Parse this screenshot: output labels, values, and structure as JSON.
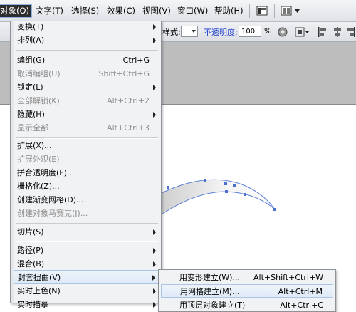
{
  "menubar": {
    "items": [
      "对象(O)",
      "文字(T)",
      "选择(S)",
      "效果(C)",
      "视图(V)",
      "窗口(W)",
      "帮助(H)"
    ]
  },
  "toolbar": {
    "style_label": "样式:",
    "opacity_label": "不透明度:",
    "opacity_value": "100",
    "percent": "%"
  },
  "object_menu": {
    "items": [
      {
        "label": "变换(T)",
        "shortcut": "",
        "submenu": true,
        "disabled": false
      },
      {
        "label": "排列(A)",
        "shortcut": "",
        "submenu": true,
        "disabled": false
      },
      {
        "label": "编组(G)",
        "shortcut": "Ctrl+G",
        "submenu": false,
        "disabled": false
      },
      {
        "label": "取消编组(U)",
        "shortcut": "Shift+Ctrl+G",
        "submenu": false,
        "disabled": true
      },
      {
        "label": "锁定(L)",
        "shortcut": "",
        "submenu": true,
        "disabled": false
      },
      {
        "label": "全部解锁(K)",
        "shortcut": "Alt+Ctrl+2",
        "submenu": false,
        "disabled": true
      },
      {
        "label": "隐藏(H)",
        "shortcut": "",
        "submenu": true,
        "disabled": false
      },
      {
        "label": "显示全部",
        "shortcut": "Alt+Ctrl+3",
        "submenu": false,
        "disabled": true
      },
      {
        "label": "扩展(X)...",
        "shortcut": "",
        "submenu": false,
        "disabled": false
      },
      {
        "label": "扩展外观(E)",
        "shortcut": "",
        "submenu": false,
        "disabled": true
      },
      {
        "label": "拼合透明度(F)...",
        "shortcut": "",
        "submenu": false,
        "disabled": false
      },
      {
        "label": "栅格化(Z)...",
        "shortcut": "",
        "submenu": false,
        "disabled": false
      },
      {
        "label": "创建渐变网格(D)...",
        "shortcut": "",
        "submenu": false,
        "disabled": false
      },
      {
        "label": "创建对象马赛克(J)...",
        "shortcut": "",
        "submenu": false,
        "disabled": true
      },
      {
        "label": "切片(S)",
        "shortcut": "",
        "submenu": true,
        "disabled": false
      },
      {
        "label": "路径(P)",
        "shortcut": "",
        "submenu": true,
        "disabled": false
      },
      {
        "label": "混合(B)",
        "shortcut": "",
        "submenu": true,
        "disabled": false
      },
      {
        "label": "封套扭曲(V)",
        "shortcut": "",
        "submenu": true,
        "disabled": false
      },
      {
        "label": "实时上色(N)",
        "shortcut": "",
        "submenu": true,
        "disabled": false
      },
      {
        "label": "实时描摹",
        "shortcut": "",
        "submenu": true,
        "disabled": false
      }
    ]
  },
  "envelope_submenu": {
    "items": [
      {
        "label": "用变形建立(W)...",
        "shortcut": "Alt+Shift+Ctrl+W"
      },
      {
        "label": "用网格建立(M)...",
        "shortcut": "Alt+Ctrl+M"
      },
      {
        "label": "用顶层对象建立(T)",
        "shortcut": "Alt+Ctrl+C"
      }
    ]
  }
}
